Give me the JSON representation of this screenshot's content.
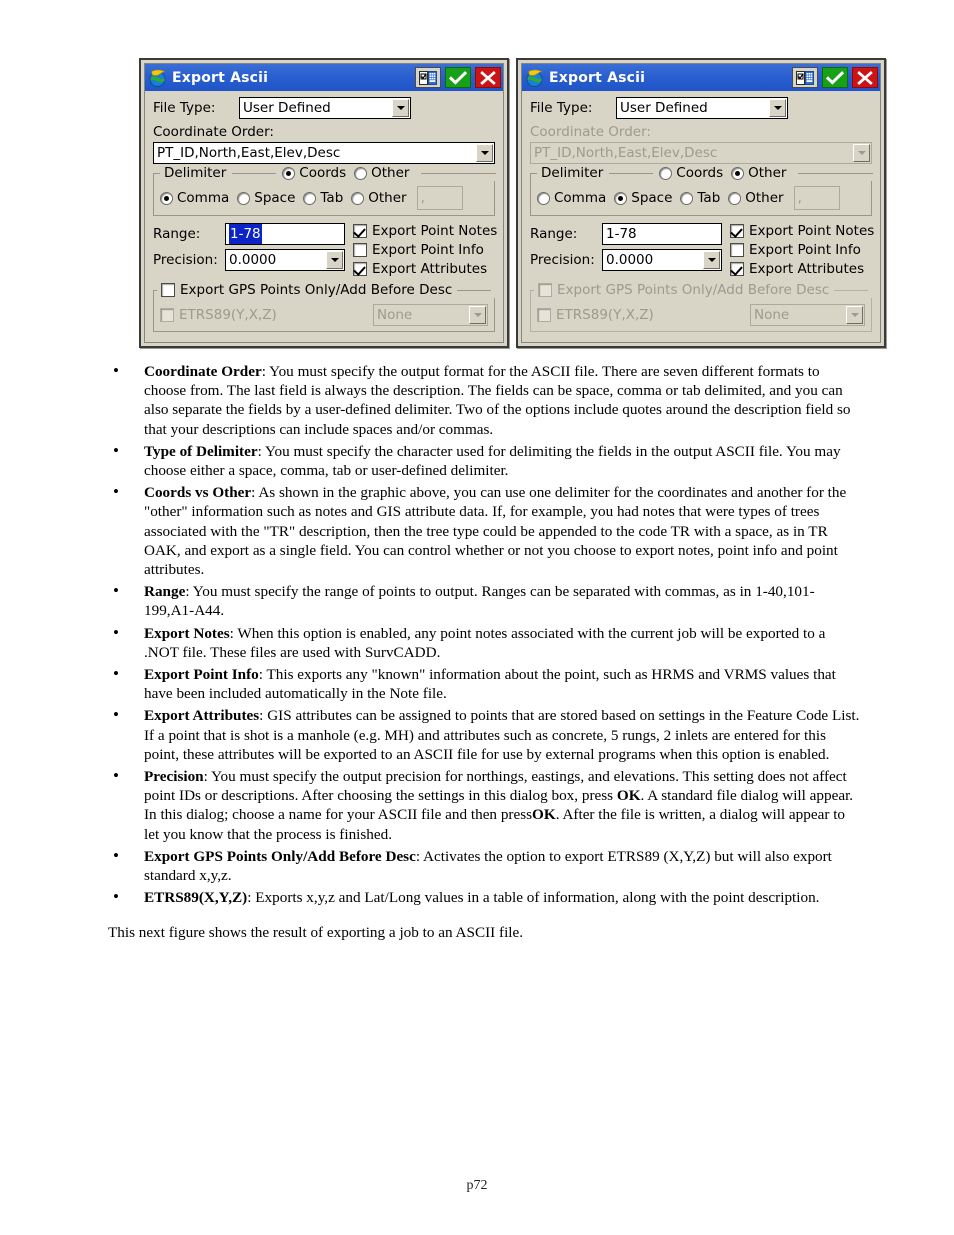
{
  "figure": {
    "dialogs": [
      {
        "id": "left",
        "title": "Export Ascii",
        "titlebar_buttons": {
          "keyboard": "keyboard-icon",
          "ok": "checkmark-icon",
          "cancel": "close-icon"
        },
        "file_type": {
          "label": "File Type:",
          "value": "User Defined",
          "disabled": false
        },
        "coordinate_order": {
          "label": "Coordinate Order:",
          "value": "PT_ID,North,East,Elev,Desc",
          "disabled": false
        },
        "delimiter": {
          "legend": "Delimiter",
          "scope_options": [
            {
              "label": "Coords",
              "selected": true,
              "disabled": false
            },
            {
              "label": "Other",
              "selected": false,
              "disabled": false
            }
          ],
          "char_options": [
            {
              "label": "Comma",
              "selected": true,
              "disabled": false
            },
            {
              "label": "Space",
              "selected": false,
              "disabled": false
            },
            {
              "label": "Tab",
              "selected": false,
              "disabled": false
            },
            {
              "label": "Other",
              "selected": false,
              "disabled": false
            }
          ],
          "custom_value": ","
        },
        "range": {
          "label": "Range:",
          "value": "1-78",
          "selected": true
        },
        "precision": {
          "label": "Precision:",
          "value": "0.0000"
        },
        "checkboxes": [
          {
            "label": "Export Point Notes",
            "checked": true,
            "disabled": false
          },
          {
            "label": "Export Point Info",
            "checked": false,
            "disabled": false
          },
          {
            "label": "Export Attributes",
            "checked": true,
            "disabled": false
          }
        ],
        "gps_group": {
          "label": "Export GPS Points Only/Add Before Desc",
          "checked": false,
          "disabled": false,
          "etrs89": {
            "label": "ETRS89(Y,X,Z)",
            "checked": false,
            "disabled": true
          },
          "etrs89_value": "None"
        }
      },
      {
        "id": "right",
        "title": "Export Ascii",
        "titlebar_buttons": {
          "keyboard": "keyboard-icon",
          "ok": "checkmark-icon",
          "cancel": "close-icon"
        },
        "file_type": {
          "label": "File Type:",
          "value": "User Defined",
          "disabled": false
        },
        "coordinate_order": {
          "label": "Coordinate Order:",
          "value": "PT_ID,North,East,Elev,Desc",
          "disabled": true
        },
        "delimiter": {
          "legend": "Delimiter",
          "scope_options": [
            {
              "label": "Coords",
              "selected": false,
              "disabled": false
            },
            {
              "label": "Other",
              "selected": true,
              "disabled": false
            }
          ],
          "char_options": [
            {
              "label": "Comma",
              "selected": false,
              "disabled": false
            },
            {
              "label": "Space",
              "selected": true,
              "disabled": false
            },
            {
              "label": "Tab",
              "selected": false,
              "disabled": false
            },
            {
              "label": "Other",
              "selected": false,
              "disabled": false
            }
          ],
          "custom_value": ","
        },
        "range": {
          "label": "Range:",
          "value": "1-78",
          "selected": false
        },
        "precision": {
          "label": "Precision:",
          "value": "0.0000"
        },
        "checkboxes": [
          {
            "label": "Export Point Notes",
            "checked": true,
            "disabled": false
          },
          {
            "label": "Export Point Info",
            "checked": false,
            "disabled": false
          },
          {
            "label": "Export Attributes",
            "checked": true,
            "disabled": false
          }
        ],
        "gps_group": {
          "label": "Export GPS Points Only/Add Before Desc",
          "checked": false,
          "disabled": true,
          "etrs89": {
            "label": "ETRS89(Y,X,Z)",
            "checked": false,
            "disabled": true
          },
          "etrs89_value": "None"
        }
      }
    ]
  },
  "doc": {
    "bullets": [
      {
        "term": "Coordinate Order",
        "text": ": You must specify the output format for the ASCII file. There are seven different formats to choose from. The last field is always the description.  The fields can be space, comma or tab delimited, and you can also separate the fields by a user-defined delimiter. Two of the options include quotes around the description field so that your descriptions can include spaces and/or commas."
      },
      {
        "term": "Type of Delimiter",
        "text": ":  You must specify the character used for delimiting the fields in the output ASCII file. You may choose either a space, comma, tab or user-defined delimiter."
      },
      {
        "term": "Coords vs Other",
        "text": ":  As shown in the graphic above, you can use one delimiter for the coordinates and another for the \"other\" information such as notes and GIS attribute data.  If, for example, you had notes that were types of trees associated with the \"TR\" description, then the tree type could be appended to the code TR with a space, as in TR OAK, and export as a single field.  You can control whether or not you choose to export notes, point info and point attributes."
      },
      {
        "term": "Range",
        "text": ":  You must specify the range of points to output. Ranges can be separated with commas, as in 1-40,101-199,A1-A44."
      },
      {
        "term": "Export Notes",
        "text": ": When this option is enabled, any point notes associated with the current job will be exported to a .NOT file. These files are used with SurvCADD."
      },
      {
        "term": "Export Point Info",
        "text": ":  This exports any \"known\" information about the point, such as HRMS and VRMS values that have been included automatically in the Note file."
      },
      {
        "term": "Export Attributes",
        "text": ": GIS attributes can be assigned to points that are stored based on settings in the Feature Code List.  If a point that is shot is a manhole (e.g. MH) and attributes such as concrete, 5 rungs, 2 inlets are entered for this point, these attributes will be exported to an ASCII file for use by external programs when this option is enabled."
      },
      {
        "term": "Precision",
        "text": ":  You must specify the output precision for northings, eastings, and elevations. This setting does not affect point IDs or descriptions. After choosing the settings in this dialog box, press ",
        "text2": ". A standard file dialog will appear. In this dialog; choose a name for your ASCII file and then press",
        "text3": ". After the file is written, a dialog will appear to let you know that the process is finished.",
        "bold_mid1": "OK",
        "bold_mid2": "OK"
      },
      {
        "term": "Export GPS Points Only/Add Before Desc",
        "text": ":  Activates the option to export ETRS89 (X,Y,Z) but will also export standard x,y,z."
      },
      {
        "term": "ETRS89(X,Y,Z)",
        "text": ": Exports x,y,z and Lat/Long values in a table of information, along with the point description."
      }
    ],
    "closing": "This next figure shows the result of exporting a job to an ASCII file."
  },
  "footer": {
    "page_label": "p72"
  }
}
